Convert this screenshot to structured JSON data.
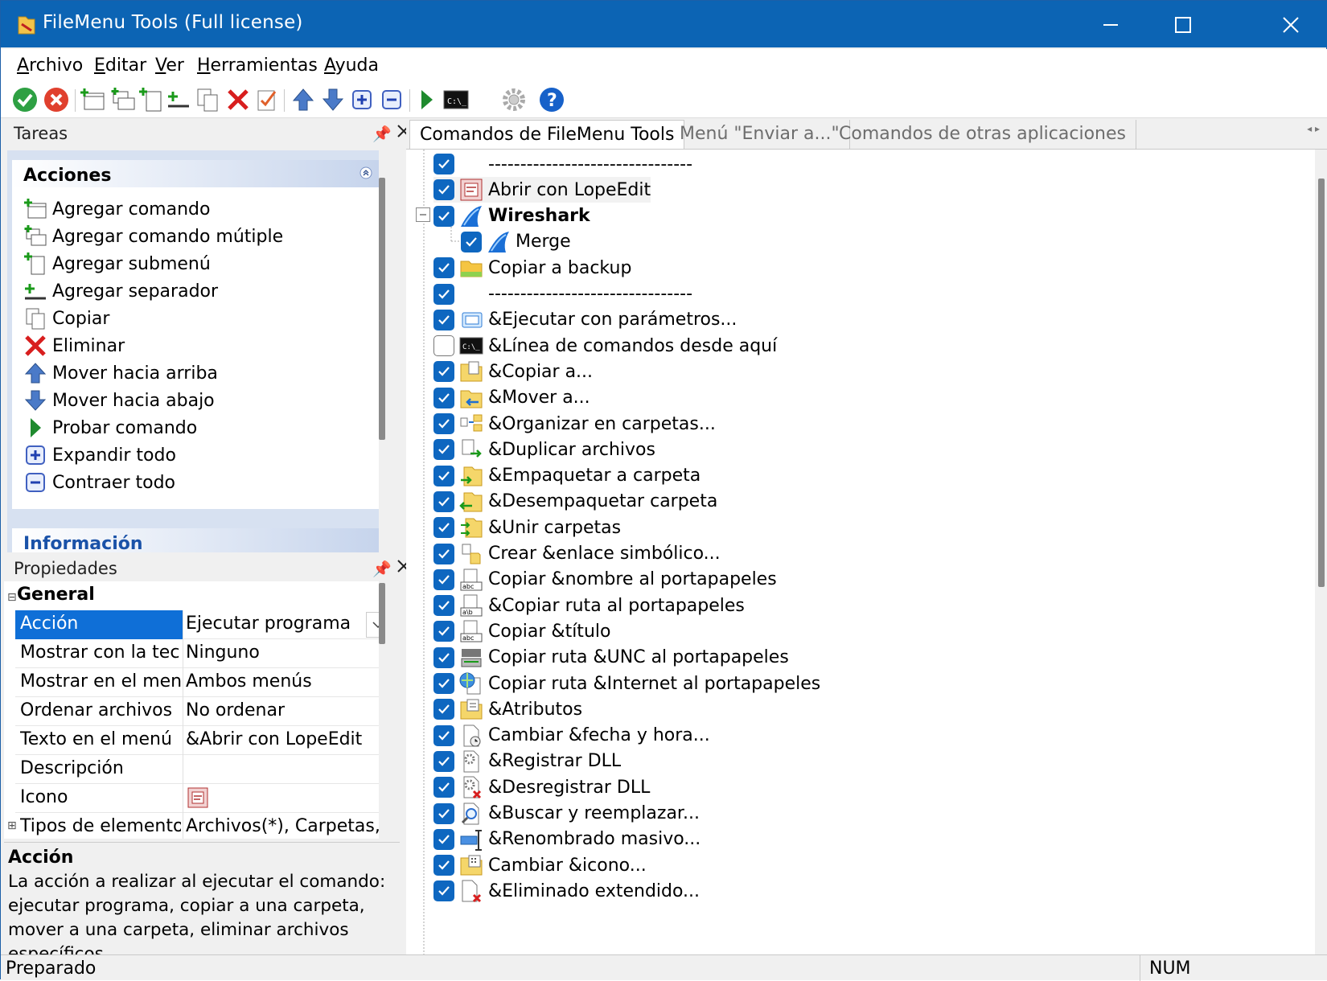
{
  "window": {
    "title": "FileMenu Tools (Full license)"
  },
  "menu": [
    {
      "ul": "A",
      "rest": "rchivo"
    },
    {
      "ul": "E",
      "rest": "ditar"
    },
    {
      "ul": "V",
      "rest": "er"
    },
    {
      "ul": "H",
      "rest": "erramientas"
    },
    {
      "ul": "A",
      "rest": "yuda"
    }
  ],
  "toolbar": [
    "accept-icon",
    "cancel-icon",
    "add-command-icon",
    "add-multiple-icon",
    "add-submenu-icon",
    "add-separator-icon",
    "copy-icon",
    "delete-icon",
    "check-list-icon",
    "move-up-icon",
    "move-down-icon",
    "expand-icon",
    "collapse-icon",
    "run-icon",
    "console-icon",
    "settings-icon",
    "help-icon"
  ],
  "tasks": {
    "title": "Tareas",
    "group_title": "Acciones",
    "items": [
      "Agregar comando",
      "Agregar comando mútiple",
      "Agregar submenú",
      "Agregar separador",
      "Copiar",
      "Eliminar",
      "Mover hacia arriba",
      "Mover hacia abajo",
      "Probar comando",
      "Expandir todo",
      "Contraer todo"
    ],
    "next_group": "Información"
  },
  "props": {
    "title": "Propiedades",
    "category": "General",
    "rows": [
      {
        "name": "Acción",
        "value": "Ejecutar programa"
      },
      {
        "name": "Mostrar con la tecla",
        "value": "Ninguno"
      },
      {
        "name": "Mostrar en el menú",
        "value": "Ambos menús"
      },
      {
        "name": "Ordenar archivos",
        "value": "No ordenar"
      },
      {
        "name": "Texto en el menú",
        "value": "&Abrir con LopeEdit"
      },
      {
        "name": "Descripción",
        "value": ""
      },
      {
        "name": "Icono",
        "value": ""
      },
      {
        "name": "Tipos de elementos",
        "value": "Archivos(*), Carpetas, Un"
      }
    ],
    "desc_title": "Acción",
    "desc_text": "La acción a realizar al ejecutar el comando: ejecutar programa, copiar a una carpeta, mover a una carpeta, eliminar archivos específicos,"
  },
  "tabs": [
    "Comandos de FileMenu Tools",
    "Menú \"Enviar a...\"",
    "Comandos de otras aplicaciones"
  ],
  "commands": [
    {
      "label": "--------------------------------",
      "checked": true,
      "icon": "none"
    },
    {
      "label": "Abrir con LopeEdit",
      "checked": true,
      "icon": "lopeedit-icon",
      "selected": true
    },
    {
      "label": "Wireshark",
      "checked": true,
      "icon": "wireshark-icon",
      "bold": true
    },
    {
      "label": "Merge",
      "checked": true,
      "icon": "wireshark-icon",
      "child": true
    },
    {
      "label": "Copiar a backup",
      "checked": true,
      "icon": "folder-icon"
    },
    {
      "label": "--------------------------------",
      "checked": true,
      "icon": "none"
    },
    {
      "label": "&Ejecutar con parámetros...",
      "checked": true,
      "icon": "run-params-icon"
    },
    {
      "label": "&Línea de comandos desde aquí",
      "checked": false,
      "icon": "console-icon"
    },
    {
      "label": "&Copiar a...",
      "checked": true,
      "icon": "copy-to-icon"
    },
    {
      "label": "&Mover a...",
      "checked": true,
      "icon": "move-to-icon"
    },
    {
      "label": "&Organizar en carpetas...",
      "checked": true,
      "icon": "organize-icon"
    },
    {
      "label": "&Duplicar archivos",
      "checked": true,
      "icon": "duplicate-icon"
    },
    {
      "label": "&Empaquetar a carpeta",
      "checked": true,
      "icon": "pack-icon"
    },
    {
      "label": "&Desempaquetar carpeta",
      "checked": true,
      "icon": "unpack-icon"
    },
    {
      "label": "&Unir carpetas",
      "checked": true,
      "icon": "join-icon"
    },
    {
      "label": "Crear &enlace simbólico...",
      "checked": true,
      "icon": "symlink-icon"
    },
    {
      "label": "Copiar &nombre al portapapeles",
      "checked": true,
      "icon": "copy-name-icon"
    },
    {
      "label": "&Copiar ruta al portapapeles",
      "checked": true,
      "icon": "copy-path-icon"
    },
    {
      "label": "Copiar &título",
      "checked": true,
      "icon": "copy-title-icon"
    },
    {
      "label": "Copiar ruta &UNC al portapapeles",
      "checked": true,
      "icon": "unc-icon"
    },
    {
      "label": "Copiar ruta &Internet al portapapeles",
      "checked": true,
      "icon": "internet-icon"
    },
    {
      "label": "&Atributos",
      "checked": true,
      "icon": "attributes-icon"
    },
    {
      "label": "Cambiar &fecha y hora...",
      "checked": true,
      "icon": "datetime-icon"
    },
    {
      "label": "&Registrar DLL",
      "checked": true,
      "icon": "register-dll-icon"
    },
    {
      "label": "&Desregistrar DLL",
      "checked": true,
      "icon": "unregister-dll-icon"
    },
    {
      "label": "&Buscar y reemplazar...",
      "checked": true,
      "icon": "search-replace-icon"
    },
    {
      "label": "&Renombrado masivo...",
      "checked": true,
      "icon": "rename-icon"
    },
    {
      "label": "Cambiar &icono...",
      "checked": true,
      "icon": "change-icon-icon"
    },
    {
      "label": "&Eliminado extendido...",
      "checked": true,
      "icon": "extended-delete-icon"
    }
  ],
  "status": {
    "left": "Preparado",
    "right": "NUM"
  }
}
